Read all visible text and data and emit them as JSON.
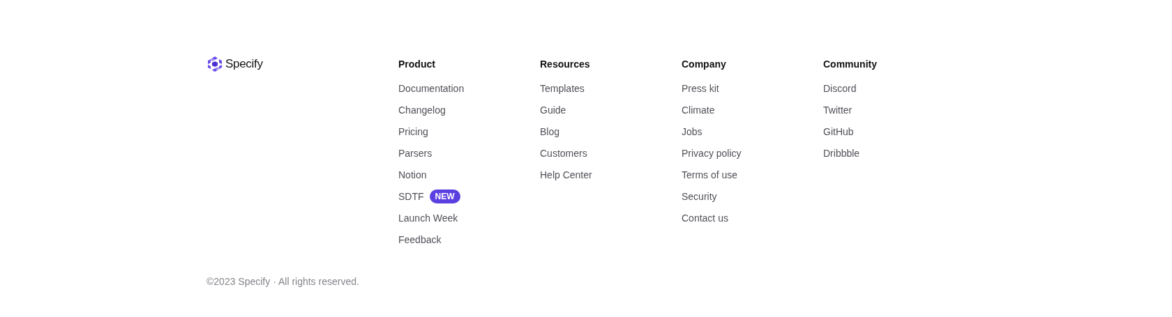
{
  "brand": {
    "name": "Specify"
  },
  "columns": [
    {
      "heading": "Product",
      "links": [
        {
          "label": "Documentation"
        },
        {
          "label": "Changelog"
        },
        {
          "label": "Pricing"
        },
        {
          "label": "Parsers"
        },
        {
          "label": "Notion"
        },
        {
          "label": "SDTF",
          "badge": "NEW"
        },
        {
          "label": "Launch Week"
        },
        {
          "label": "Feedback"
        }
      ]
    },
    {
      "heading": "Resources",
      "links": [
        {
          "label": "Templates"
        },
        {
          "label": "Guide"
        },
        {
          "label": "Blog"
        },
        {
          "label": "Customers"
        },
        {
          "label": "Help Center"
        }
      ]
    },
    {
      "heading": "Company",
      "links": [
        {
          "label": "Press kit"
        },
        {
          "label": "Climate"
        },
        {
          "label": "Jobs"
        },
        {
          "label": "Privacy policy"
        },
        {
          "label": "Terms of use"
        },
        {
          "label": "Security"
        },
        {
          "label": "Contact us"
        }
      ]
    },
    {
      "heading": "Community",
      "links": [
        {
          "label": "Discord"
        },
        {
          "label": "Twitter"
        },
        {
          "label": "GitHub"
        },
        {
          "label": "Dribbble"
        }
      ]
    }
  ],
  "copyright": "©2023 Specify · All rights reserved."
}
